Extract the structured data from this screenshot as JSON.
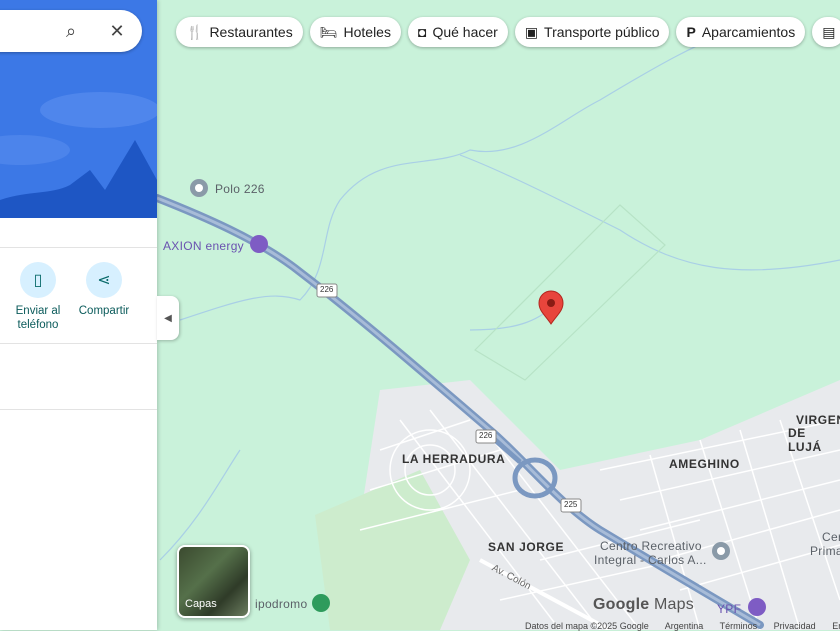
{
  "filter_chips": [
    {
      "label": "Restaurantes",
      "icon": "restaurant-icon"
    },
    {
      "label": "Hoteles",
      "icon": "hotel-icon"
    },
    {
      "label": "Qué hacer",
      "icon": "camera-icon"
    },
    {
      "label": "Transporte público",
      "icon": "transit-icon"
    },
    {
      "label": "Aparcamientos",
      "icon": "parking-icon"
    }
  ],
  "panel": {
    "actions": [
      {
        "label": "Enviar al teléfono",
        "icon": "send-to-phone-icon"
      },
      {
        "label": "Compartir",
        "icon": "share-icon"
      }
    ]
  },
  "map": {
    "places": {
      "polo": "Polo 226",
      "axion": "AXION energy",
      "herradura": "LA HERRADURA",
      "ameghino": "AMEGHINO",
      "san_jorge": "SAN JORGE",
      "virgen_1": "VIRGEN",
      "virgen_2": "DE LUJÁ",
      "centro_1": "Centro Recreativo",
      "centro_2": "Integral - Carlos A...",
      "hipodromo": "ipodromo",
      "ypf": "YPF",
      "av_colon": "Av. Colón",
      "primaria": "Cer",
      "primaria2": "Prima"
    },
    "route_shield": "226",
    "route_shield_2": "225",
    "layers_label": "Capas",
    "logo_google": "Google",
    "logo_maps": "Maps",
    "footer": [
      "Datos del mapa ©2025 Google",
      "Argentina",
      "Términos",
      "Privacidad",
      "En"
    ]
  },
  "colors": {
    "map_bg": "#c9f2da",
    "road": "#7b98c1",
    "pin": "#e8453c",
    "accent": "#3c78e6"
  }
}
